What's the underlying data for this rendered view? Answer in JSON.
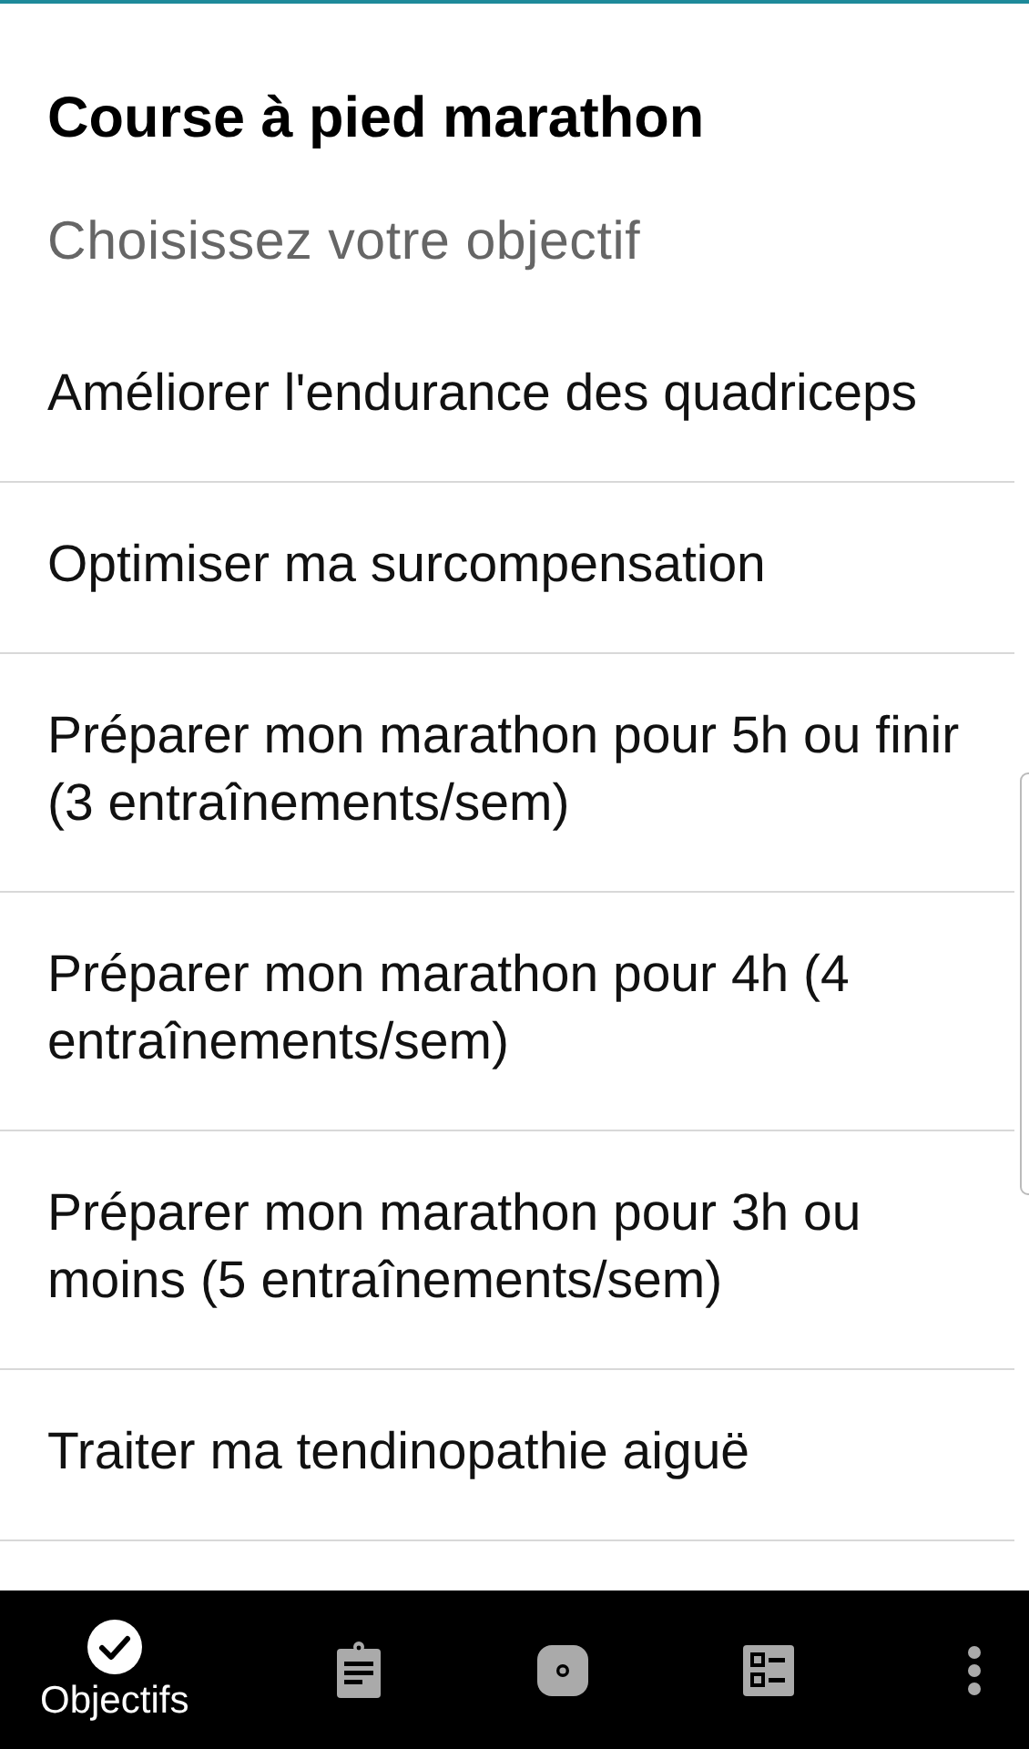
{
  "header": {
    "title": "Course à pied marathon",
    "subtitle": "Choisissez votre objectif"
  },
  "goals": [
    {
      "label": "Améliorer l'endurance des quadriceps"
    },
    {
      "label": "Optimiser ma surcompensation"
    },
    {
      "label": "Préparer mon marathon pour 5h ou finir (3 entraînements/sem)"
    },
    {
      "label": "Préparer mon marathon pour 4h (4 entraînements/sem)"
    },
    {
      "label": "Préparer mon marathon pour 3h ou moins (5 entraînements/sem)"
    },
    {
      "label": "Traiter ma tendinopathie aiguë"
    }
  ],
  "bottom_nav": [
    {
      "kind": "check",
      "label": "Objectifs",
      "selected": true
    },
    {
      "kind": "clipboard",
      "selected": false
    },
    {
      "kind": "record",
      "selected": false
    },
    {
      "kind": "checklist",
      "selected": false
    },
    {
      "kind": "more",
      "selected": false
    }
  ]
}
